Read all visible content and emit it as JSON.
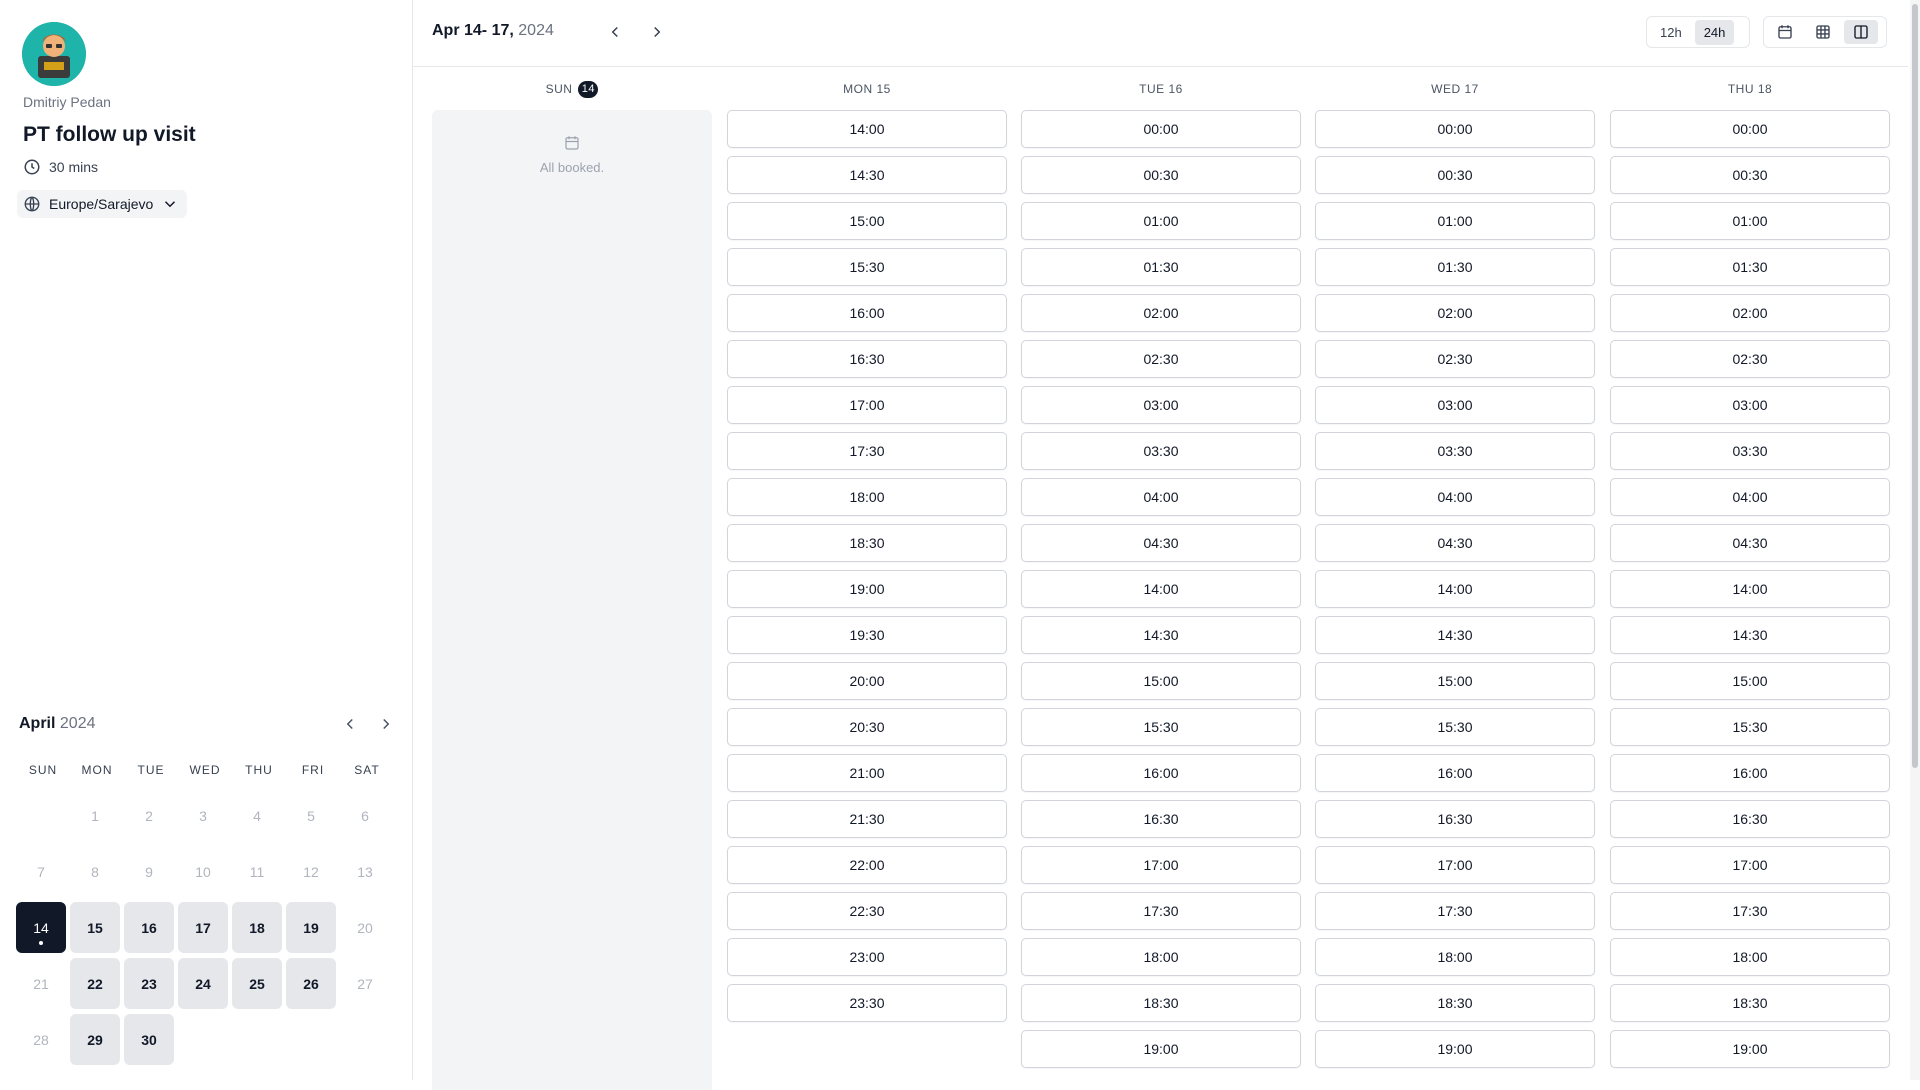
{
  "host": {
    "name": "Dmitriy Pedan"
  },
  "event": {
    "title": "PT follow up visit",
    "duration": "30 mins"
  },
  "timezone": {
    "value": "Europe/Sarajevo"
  },
  "header": {
    "range": "Apr 14- 17,",
    "year": "2024",
    "format_options": [
      "12h",
      "24h"
    ],
    "format_selected": "24h",
    "view_icons": [
      "calendar-icon",
      "grid-icon",
      "columns-icon"
    ],
    "view_selected": "columns-icon"
  },
  "mini_calendar": {
    "month": "April",
    "year": "2024",
    "weekdays": [
      "SUN",
      "MON",
      "TUE",
      "WED",
      "THU",
      "FRI",
      "SAT"
    ],
    "leading_blank": 1,
    "days": [
      {
        "d": "1",
        "s": "dis"
      },
      {
        "d": "2",
        "s": "dis"
      },
      {
        "d": "3",
        "s": "dis"
      },
      {
        "d": "4",
        "s": "dis"
      },
      {
        "d": "5",
        "s": "dis"
      },
      {
        "d": "6",
        "s": "dis"
      },
      {
        "d": "7",
        "s": "dis"
      },
      {
        "d": "8",
        "s": "dis"
      },
      {
        "d": "9",
        "s": "dis"
      },
      {
        "d": "10",
        "s": "dis"
      },
      {
        "d": "11",
        "s": "dis"
      },
      {
        "d": "12",
        "s": "dis"
      },
      {
        "d": "13",
        "s": "dis"
      },
      {
        "d": "14",
        "s": "sel"
      },
      {
        "d": "15",
        "s": "avail"
      },
      {
        "d": "16",
        "s": "avail"
      },
      {
        "d": "17",
        "s": "avail"
      },
      {
        "d": "18",
        "s": "avail"
      },
      {
        "d": "19",
        "s": "avail"
      },
      {
        "d": "20",
        "s": "dis"
      },
      {
        "d": "21",
        "s": "dis"
      },
      {
        "d": "22",
        "s": "avail"
      },
      {
        "d": "23",
        "s": "avail"
      },
      {
        "d": "24",
        "s": "avail"
      },
      {
        "d": "25",
        "s": "avail"
      },
      {
        "d": "26",
        "s": "avail"
      },
      {
        "d": "27",
        "s": "dis"
      },
      {
        "d": "28",
        "s": "dis"
      },
      {
        "d": "29",
        "s": "avail"
      },
      {
        "d": "30",
        "s": "avail"
      }
    ]
  },
  "columns": [
    {
      "label": "SUN",
      "day": "14",
      "booked": true,
      "booked_text": "All booked.",
      "slots": []
    },
    {
      "label": "MON 15",
      "slots": [
        "14:00",
        "14:30",
        "15:00",
        "15:30",
        "16:00",
        "16:30",
        "17:00",
        "17:30",
        "18:00",
        "18:30",
        "19:00",
        "19:30",
        "20:00",
        "20:30",
        "21:00",
        "21:30",
        "22:00",
        "22:30",
        "23:00",
        "23:30"
      ]
    },
    {
      "label": "TUE 16",
      "slots": [
        "00:00",
        "00:30",
        "01:00",
        "01:30",
        "02:00",
        "02:30",
        "03:00",
        "03:30",
        "04:00",
        "04:30",
        "14:00",
        "14:30",
        "15:00",
        "15:30",
        "16:00",
        "16:30",
        "17:00",
        "17:30",
        "18:00",
        "18:30",
        "19:00"
      ]
    },
    {
      "label": "WED 17",
      "slots": [
        "00:00",
        "00:30",
        "01:00",
        "01:30",
        "02:00",
        "02:30",
        "03:00",
        "03:30",
        "04:00",
        "04:30",
        "14:00",
        "14:30",
        "15:00",
        "15:30",
        "16:00",
        "16:30",
        "17:00",
        "17:30",
        "18:00",
        "18:30",
        "19:00"
      ]
    },
    {
      "label": "THU 18",
      "slots": [
        "00:00",
        "00:30",
        "01:00",
        "01:30",
        "02:00",
        "02:30",
        "03:00",
        "03:30",
        "04:00",
        "04:30",
        "14:00",
        "14:30",
        "15:00",
        "15:30",
        "16:00",
        "16:30",
        "17:00",
        "17:30",
        "18:00",
        "18:30",
        "19:00"
      ]
    }
  ]
}
